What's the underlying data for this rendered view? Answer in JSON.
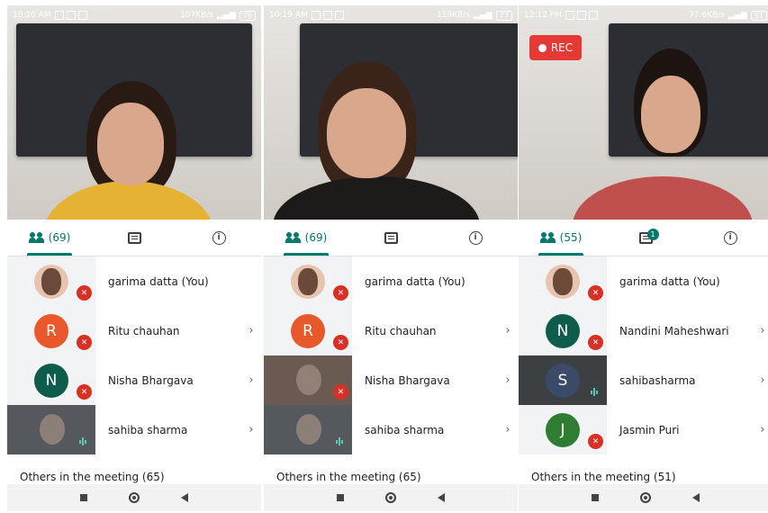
{
  "colors": {
    "accent": "#00796b",
    "mic_off": "#d93025",
    "rec": "#e53935"
  },
  "phones": [
    {
      "status": {
        "time": "10:20 AM",
        "speed": "107KB/s",
        "battery": "76"
      },
      "rec": null,
      "tabs": {
        "people_count": "(69)",
        "chat_badge": ""
      },
      "participants": [
        {
          "name": "garima datta (You)",
          "avatar": "photo",
          "letter": "",
          "color": "#e8c4b0",
          "state": "muted",
          "chevron": false,
          "thumb": "light"
        },
        {
          "name": "Ritu chauhan",
          "avatar": "letter",
          "letter": "R",
          "color": "#e8582a",
          "state": "muted",
          "chevron": true,
          "thumb": "light"
        },
        {
          "name": "Nisha Bhargava",
          "avatar": "letter",
          "letter": "N",
          "color": "#0d5c4c",
          "state": "muted",
          "chevron": true,
          "thumb": "light"
        },
        {
          "name": "sahiba sharma",
          "avatar": "video",
          "letter": "",
          "color": "#55585c",
          "state": "speaking",
          "chevron": true,
          "thumb": "dark"
        }
      ],
      "others": "Others in the meeting (65)"
    },
    {
      "status": {
        "time": "10:19 AM",
        "speed": "119KB/s",
        "battery": "77"
      },
      "rec": null,
      "tabs": {
        "people_count": "(69)",
        "chat_badge": ""
      },
      "participants": [
        {
          "name": "garima datta (You)",
          "avatar": "photo",
          "letter": "",
          "color": "#e8c4b0",
          "state": "muted",
          "chevron": false,
          "thumb": "light"
        },
        {
          "name": "Ritu chauhan",
          "avatar": "letter",
          "letter": "R",
          "color": "#e8582a",
          "state": "muted",
          "chevron": true,
          "thumb": "light"
        },
        {
          "name": "Nisha Bhargava",
          "avatar": "video",
          "letter": "",
          "color": "#6b5a52",
          "state": "muted",
          "chevron": true,
          "thumb": "dark"
        },
        {
          "name": "sahiba sharma",
          "avatar": "video",
          "letter": "",
          "color": "#55585c",
          "state": "speaking",
          "chevron": true,
          "thumb": "dark"
        }
      ],
      "others": "Others in the meeting (65)"
    },
    {
      "status": {
        "time": "12:12 PM",
        "speed": "77.6KB/s",
        "battery": "51"
      },
      "rec": "REC",
      "tabs": {
        "people_count": "(55)",
        "chat_badge": "1"
      },
      "participants": [
        {
          "name": "garima datta (You)",
          "avatar": "photo",
          "letter": "",
          "color": "#e8c4b0",
          "state": "muted",
          "chevron": false,
          "thumb": "light"
        },
        {
          "name": "Nandini Maheshwari",
          "avatar": "letter",
          "letter": "N",
          "color": "#0d5c4c",
          "state": "muted",
          "chevron": true,
          "thumb": "light"
        },
        {
          "name": "sahibasharma",
          "avatar": "letter",
          "letter": "S",
          "color": "#3b4a66",
          "state": "speaking",
          "chevron": true,
          "thumb": "dark"
        },
        {
          "name": "Jasmin Puri",
          "avatar": "letter",
          "letter": "J",
          "color": "#2e7d32",
          "state": "muted",
          "chevron": true,
          "thumb": "light"
        }
      ],
      "others": "Others in the meeting (51)"
    }
  ]
}
